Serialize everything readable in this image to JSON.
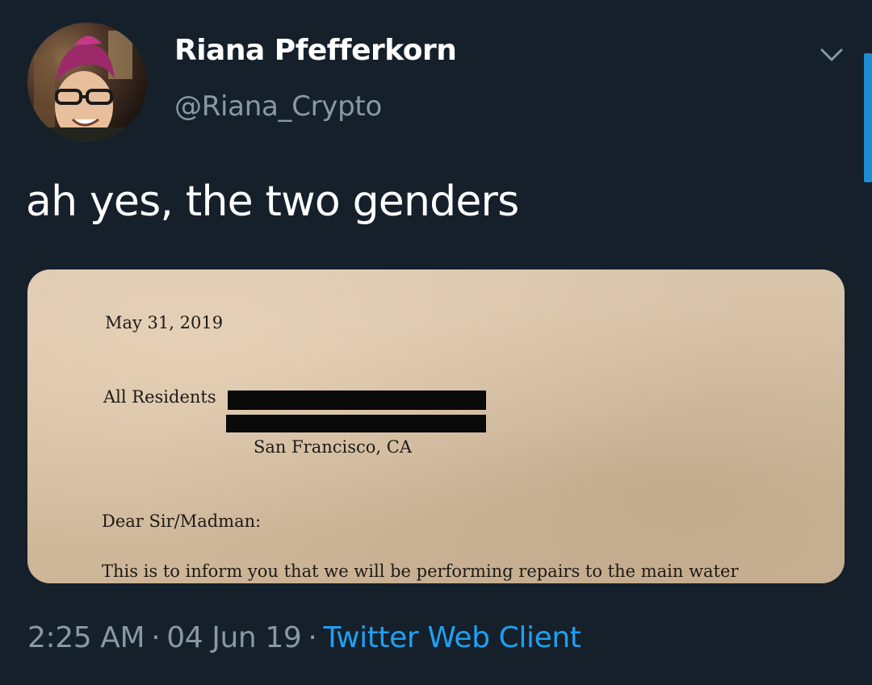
{
  "tweet": {
    "display_name": "Riana Pfefferkorn",
    "handle": "@Riana_Crypto",
    "text": "ah yes, the two genders",
    "timestamp_time": "2:25 AM",
    "separator": "·",
    "timestamp_date": "04 Jun 19",
    "source": "Twitter Web Client"
  },
  "media": {
    "letter_date": "May 31, 2019",
    "recipient": "All Residents",
    "city": "San Francisco, CA",
    "salutation": "Dear Sir/Madman:",
    "body_line": "This is to inform you that we will be performing repairs to the main water"
  },
  "icons": {
    "caret": "chevron-down-icon",
    "avatar": "profile-photo"
  },
  "colors": {
    "background": "#15202b",
    "primary_text": "#ffffff",
    "secondary_text": "#8899a6",
    "accent": "#1da1f2",
    "paper": "#d6c0a4"
  }
}
